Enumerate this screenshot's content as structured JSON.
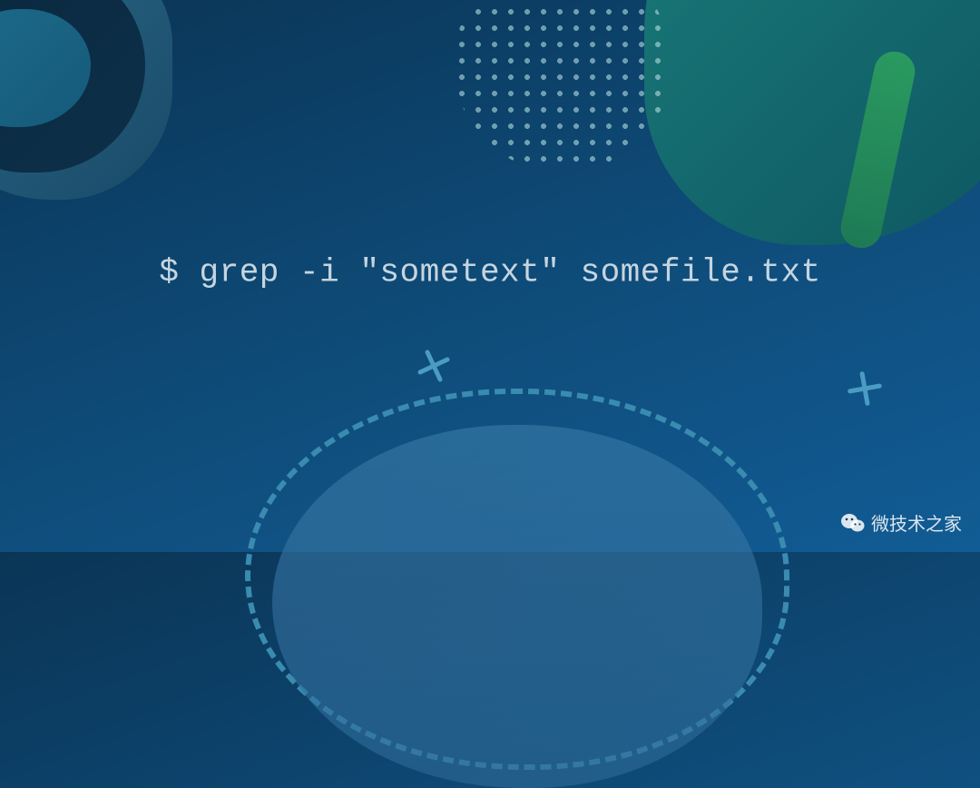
{
  "command": {
    "text": "$ grep -i \"sometext\" somefile.txt"
  },
  "watermark": {
    "label": "微技术之家"
  }
}
